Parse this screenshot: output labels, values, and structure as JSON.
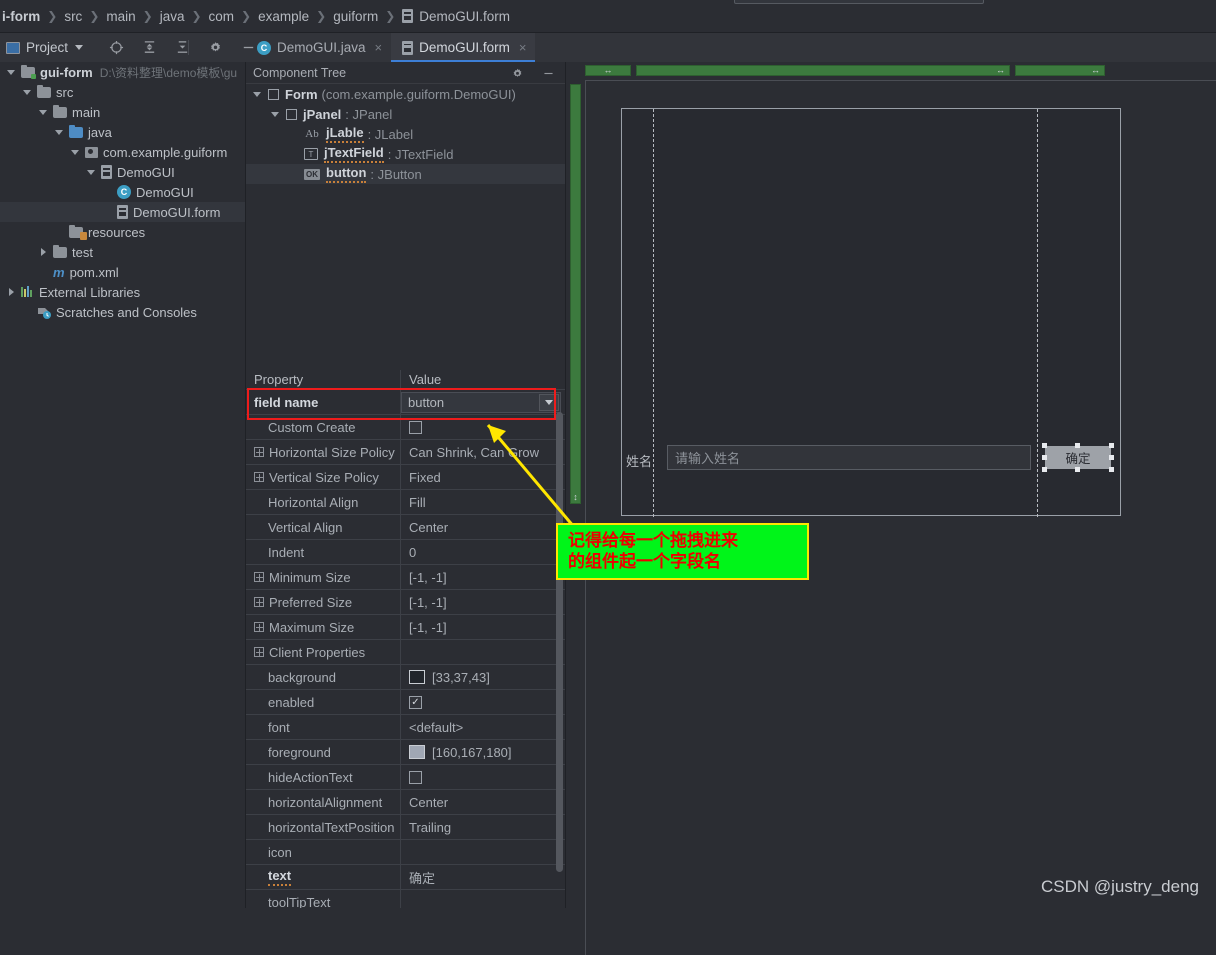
{
  "breadcrumb": {
    "items": [
      "i-form",
      "src",
      "main",
      "java",
      "com",
      "example",
      "guiform",
      "DemoGUI.form"
    ],
    "separator": "❯"
  },
  "toolbar": {
    "project_label": "Project",
    "icons": [
      "locate-icon",
      "collapse-all-icon",
      "expand-all-icon",
      "gear-icon",
      "hide-icon"
    ]
  },
  "editor_tabs": [
    {
      "label": "DemoGUI.java",
      "icon": "java-class-icon",
      "active": false,
      "close": "×"
    },
    {
      "label": "DemoGUI.form",
      "icon": "form-file-icon",
      "active": true,
      "close": "×"
    }
  ],
  "project_tree": [
    {
      "label": "gui-form",
      "path": "D:\\资料整理\\demo模板\\gu",
      "indent": 0,
      "arrow": "down",
      "icon": "module-folder-icon",
      "bold": true,
      "selected": false
    },
    {
      "label": "src",
      "path": "",
      "indent": 1,
      "arrow": "down",
      "icon": "folder-icon",
      "bold": false,
      "selected": false
    },
    {
      "label": "main",
      "path": "",
      "indent": 2,
      "arrow": "down",
      "icon": "folder-icon",
      "bold": false,
      "selected": false
    },
    {
      "label": "java",
      "path": "",
      "indent": 3,
      "arrow": "down",
      "icon": "source-folder-icon",
      "bold": false,
      "selected": false
    },
    {
      "label": "com.example.guiform",
      "path": "",
      "indent": 4,
      "arrow": "down",
      "icon": "package-icon",
      "bold": false,
      "selected": false
    },
    {
      "label": "DemoGUI",
      "path": "",
      "indent": 5,
      "arrow": "down",
      "icon": "form-file-icon",
      "bold": false,
      "selected": false
    },
    {
      "label": "DemoGUI",
      "path": "",
      "indent": 6,
      "arrow": "none",
      "icon": "java-class-icon",
      "bold": false,
      "selected": false
    },
    {
      "label": "DemoGUI.form",
      "path": "",
      "indent": 6,
      "arrow": "none",
      "icon": "form-file-icon",
      "bold": false,
      "selected": true
    },
    {
      "label": "resources",
      "path": "",
      "indent": 3,
      "arrow": "none",
      "icon": "resources-folder-icon",
      "bold": false,
      "selected": false
    },
    {
      "label": "test",
      "path": "",
      "indent": 2,
      "arrow": "right",
      "icon": "folder-icon",
      "bold": false,
      "selected": false
    },
    {
      "label": "pom.xml",
      "path": "",
      "indent": 2,
      "arrow": "none",
      "icon": "maven-icon",
      "bold": false,
      "selected": false
    },
    {
      "label": "External Libraries",
      "path": "",
      "indent": 0,
      "arrow": "right",
      "icon": "libraries-icon",
      "bold": false,
      "selected": false
    },
    {
      "label": "Scratches and Consoles",
      "path": "",
      "indent": 1,
      "arrow": "none",
      "icon": "scratches-icon",
      "bold": false,
      "selected": false
    }
  ],
  "component_tree": {
    "title": "Component Tree",
    "nodes": [
      {
        "icon": "checkbox-icon",
        "name": "Form",
        "type": "(com.example.guiform.DemoGUI)",
        "sep": "",
        "indent": 0,
        "arrow": "down",
        "selected": false,
        "squiggle": false
      },
      {
        "icon": "checkbox-icon",
        "name": "jPanel",
        "type": "JPanel",
        "sep": " : ",
        "indent": 1,
        "arrow": "down",
        "selected": false,
        "squiggle": false
      },
      {
        "icon": "label-icon",
        "name": "jLable",
        "type": "JLabel",
        "sep": " : ",
        "indent": 2,
        "arrow": "none",
        "selected": false,
        "squiggle": true
      },
      {
        "icon": "textfield-icon",
        "name": "jTextField",
        "type": "JTextField",
        "sep": " : ",
        "indent": 2,
        "arrow": "none",
        "selected": false,
        "squiggle": true
      },
      {
        "icon": "button-icon",
        "name": "button",
        "type": "JButton",
        "sep": " : ",
        "indent": 2,
        "arrow": "none",
        "selected": true,
        "squiggle": true
      }
    ]
  },
  "property_table": {
    "headers": {
      "property": "Property",
      "value": "Value"
    },
    "field_name": {
      "label": "field name",
      "value": "button"
    },
    "rows": [
      {
        "name": "Custom Create",
        "value": "",
        "expander": false,
        "indent": true,
        "control": "checkbox",
        "checked": false,
        "bold": false
      },
      {
        "name": "Horizontal Size Policy",
        "value": "Can Shrink, Can Grow",
        "expander": true,
        "indent": false,
        "control": "text",
        "bold": false
      },
      {
        "name": "Vertical Size Policy",
        "value": "Fixed",
        "expander": true,
        "indent": false,
        "control": "text",
        "bold": false
      },
      {
        "name": "Horizontal Align",
        "value": "Fill",
        "expander": false,
        "indent": true,
        "control": "text",
        "bold": false
      },
      {
        "name": "Vertical Align",
        "value": "Center",
        "expander": false,
        "indent": true,
        "control": "text",
        "bold": false
      },
      {
        "name": "Indent",
        "value": "0",
        "expander": false,
        "indent": true,
        "control": "text",
        "bold": false
      },
      {
        "name": "Minimum Size",
        "value": "[-1, -1]",
        "expander": true,
        "indent": false,
        "control": "text",
        "bold": false
      },
      {
        "name": "Preferred Size",
        "value": "[-1, -1]",
        "expander": true,
        "indent": false,
        "control": "text",
        "bold": false
      },
      {
        "name": "Maximum Size",
        "value": "[-1, -1]",
        "expander": true,
        "indent": false,
        "control": "text",
        "bold": false
      },
      {
        "name": "Client Properties",
        "value": "",
        "expander": true,
        "indent": false,
        "control": "text",
        "bold": false
      },
      {
        "name": "background",
        "value": "[33,37,43]",
        "expander": false,
        "indent": true,
        "control": "color",
        "swatch": "#21252b",
        "bold": false
      },
      {
        "name": "enabled",
        "value": "",
        "expander": false,
        "indent": true,
        "control": "checkbox",
        "checked": true,
        "bold": false
      },
      {
        "name": "font",
        "value": "<default>",
        "expander": false,
        "indent": true,
        "control": "text",
        "bold": false
      },
      {
        "name": "foreground",
        "value": "[160,167,180]",
        "expander": false,
        "indent": true,
        "control": "color",
        "swatch": "#a0a7b4",
        "bold": false
      },
      {
        "name": "hideActionText",
        "value": "",
        "expander": false,
        "indent": true,
        "control": "checkbox",
        "checked": false,
        "bold": false
      },
      {
        "name": "horizontalAlignment",
        "value": "Center",
        "expander": false,
        "indent": true,
        "control": "text",
        "bold": false
      },
      {
        "name": "horizontalTextPosition",
        "value": "Trailing",
        "expander": false,
        "indent": true,
        "control": "text",
        "bold": false
      },
      {
        "name": "icon",
        "value": "",
        "expander": false,
        "indent": true,
        "control": "text",
        "bold": false
      },
      {
        "name": "text",
        "value": "确定",
        "expander": false,
        "indent": true,
        "control": "text",
        "bold": true
      },
      {
        "name": "toolTipText",
        "value": "",
        "expander": false,
        "indent": true,
        "control": "text",
        "bold": false
      }
    ]
  },
  "designer": {
    "label_text": "姓名",
    "textfield_placeholder": "请输入姓名",
    "button_text": "确定",
    "gutter_arrow_h": "↔",
    "gutter_arrow_v": "↕"
  },
  "callout": {
    "line1": "记得给每一个拖拽进来",
    "line2": "的组件起一个字段名",
    "bg_color": "#00f519",
    "border_color": "#ffe600",
    "text_color": "#ee0000",
    "arrow_color": "#ffe600"
  },
  "watermark": {
    "text": "CSDN @justry_deng"
  },
  "colors": {
    "background": "#2b2d33",
    "panel": "#32343a",
    "accent": "#3d7fd6",
    "selection": "#33363d",
    "highlight_box": "#ee1c1c",
    "gutter_green": "#3c7a3e"
  }
}
